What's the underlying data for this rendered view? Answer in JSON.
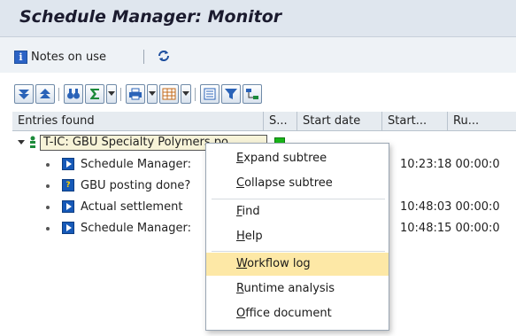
{
  "window": {
    "title": "Schedule Manager: Monitor"
  },
  "app_toolbar": {
    "notes_label": "Notes on use"
  },
  "grid": {
    "headers": [
      "Entries found",
      "S...",
      "Start date",
      "Start...",
      "Ru..."
    ],
    "root": {
      "label": "T-IC: GBU Specialty Polymers po"
    },
    "rows": [
      {
        "label": "Schedule Manager:",
        "time": "10:23:18 00:00:0",
        "icon": "step-icon"
      },
      {
        "label": "GBU posting done?",
        "time": "",
        "icon": "decision-icon"
      },
      {
        "label": "Actual settlement",
        "time": "10:48:03 00:00:0",
        "icon": "step-icon"
      },
      {
        "label": "Schedule Manager:",
        "time": "10:48:15 00:00:0",
        "icon": "step-icon"
      }
    ]
  },
  "context_menu": {
    "items": [
      {
        "acc": "E",
        "rest": "xpand subtree"
      },
      {
        "acc": "C",
        "rest": "ollapse subtree"
      },
      {
        "acc": "F",
        "rest": "ind"
      },
      {
        "acc": "H",
        "rest": "elp"
      },
      {
        "acc": "W",
        "rest": "orkflow log"
      },
      {
        "acc": "R",
        "rest": "untime analysis"
      },
      {
        "acc": "O",
        "rest": "ffice document"
      }
    ],
    "highlighted": "Workflow log"
  },
  "colors": {
    "title_bar": "#dfe6ee",
    "highlight": "#fde8a6",
    "status_green": "#19b619",
    "node_blue": "#1659b8"
  }
}
